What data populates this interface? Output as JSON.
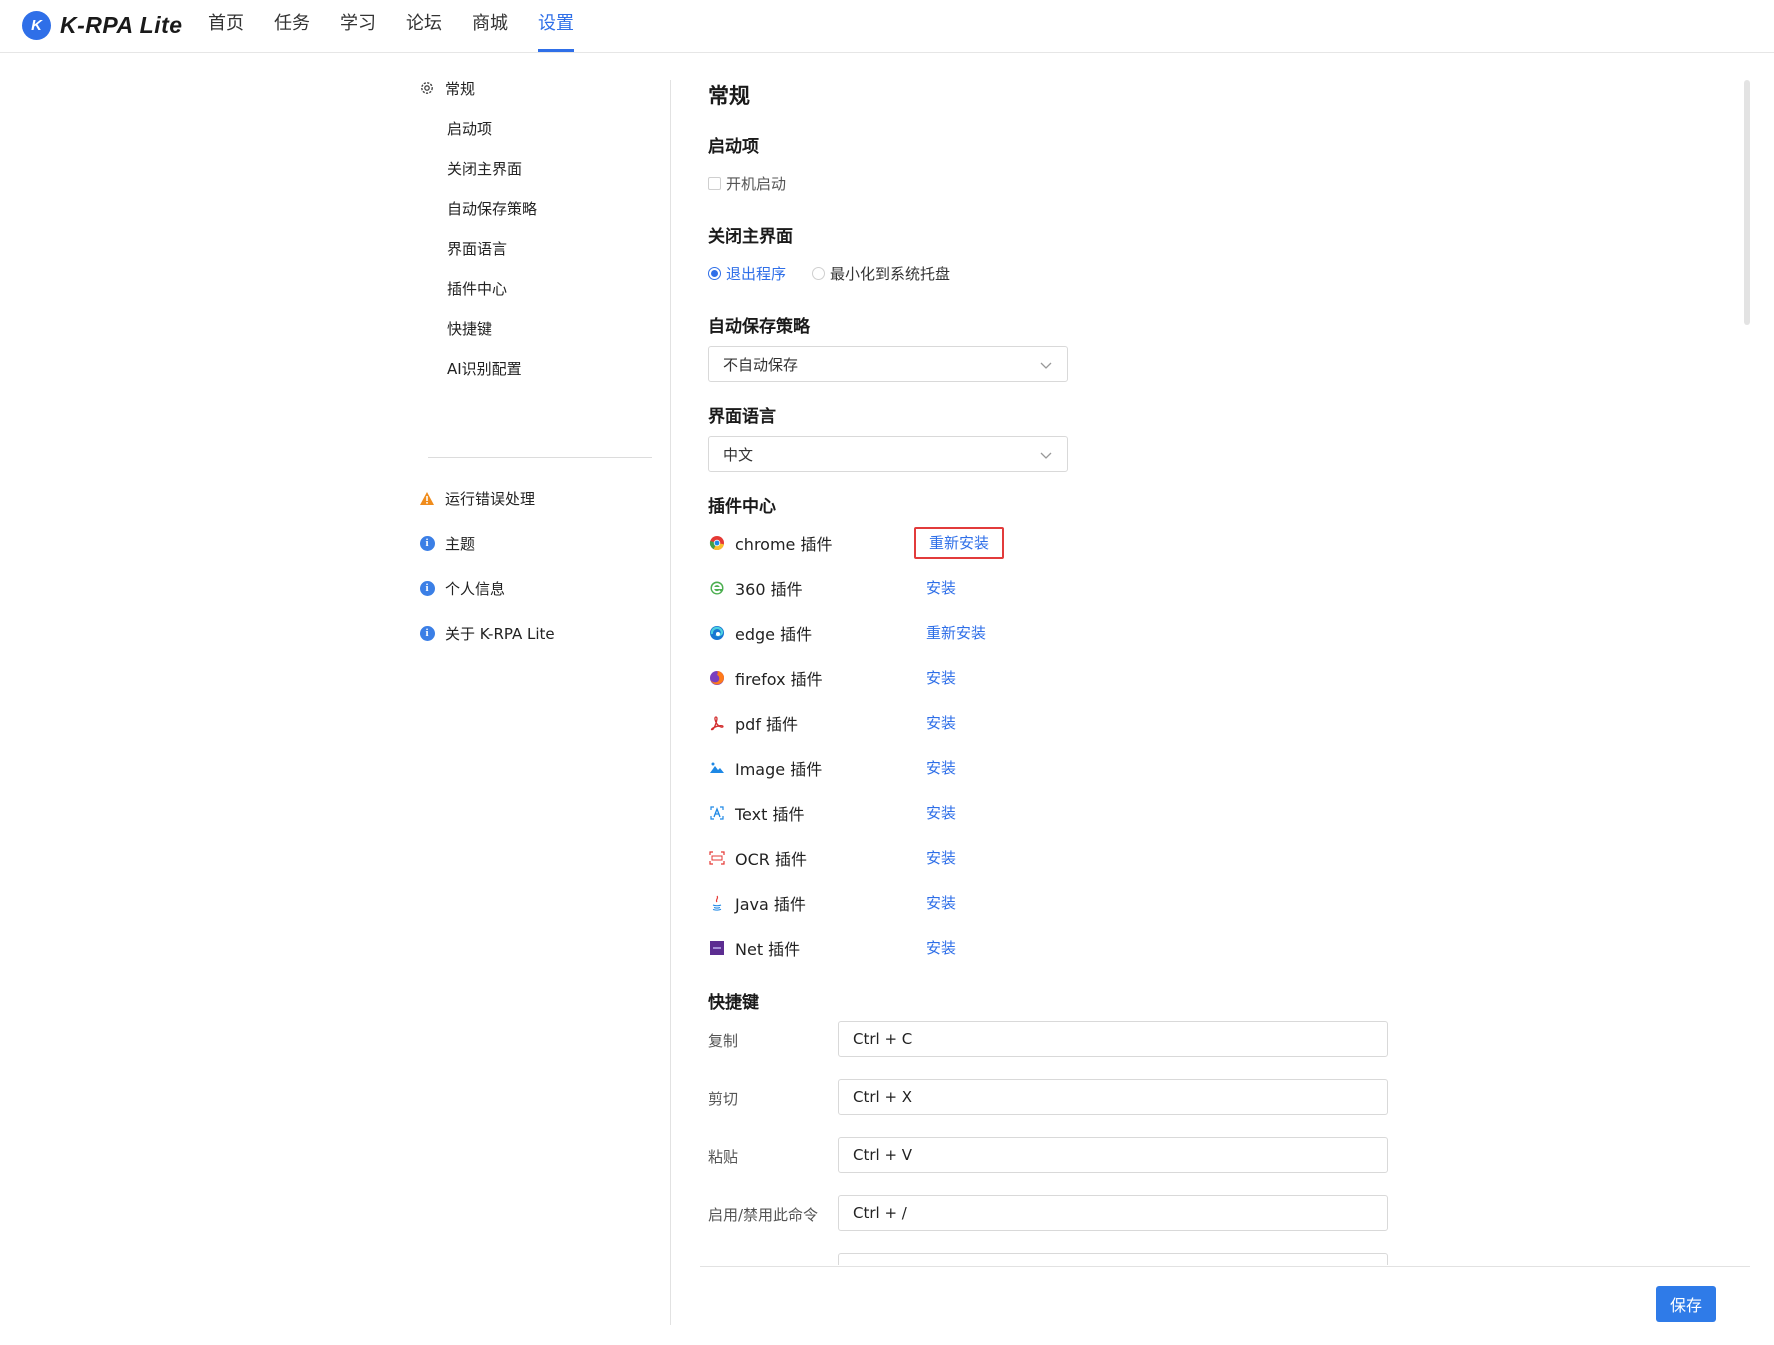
{
  "app": {
    "logo_letter": "K",
    "name": "K-RPA Lite"
  },
  "nav": [
    {
      "label": "首页",
      "active": false
    },
    {
      "label": "任务",
      "active": false
    },
    {
      "label": "学习",
      "active": false
    },
    {
      "label": "论坛",
      "active": false
    },
    {
      "label": "商城",
      "active": false
    },
    {
      "label": "设置",
      "active": true
    }
  ],
  "sidebar": {
    "general": "常规",
    "sub_items": [
      "启动项",
      "关闭主界面",
      "自动保存策略",
      "界面语言",
      "插件中心",
      "快捷键",
      "AI识别配置"
    ],
    "error_handling": "运行错误处理",
    "theme": "主题",
    "profile": "个人信息",
    "about": "关于 K-RPA Lite"
  },
  "content": {
    "title": "常规",
    "startup": {
      "heading": "启动项",
      "boot_label": "开机启动",
      "boot_checked": false
    },
    "close_main": {
      "heading": "关闭主界面",
      "exit_label": "退出程序",
      "minimize_label": "最小化到系统托盘",
      "selected": "exit"
    },
    "autosave": {
      "heading": "自动保存策略",
      "value": "不自动保存"
    },
    "language": {
      "heading": "界面语言",
      "value": "中文"
    },
    "plugins": {
      "heading": "插件中心",
      "items": [
        {
          "icon": "chrome-icon",
          "name": "chrome 插件",
          "action": "重新安装"
        },
        {
          "icon": "360-browser-icon",
          "name": "360 插件",
          "action": "安装"
        },
        {
          "icon": "edge-icon",
          "name": "edge 插件",
          "action": "重新安装"
        },
        {
          "icon": "firefox-icon",
          "name": "firefox 插件",
          "action": "安装"
        },
        {
          "icon": "pdf-icon",
          "name": "pdf 插件",
          "action": "安装"
        },
        {
          "icon": "image-icon",
          "name": "Image 插件",
          "action": "安装"
        },
        {
          "icon": "text-icon",
          "name": "Text 插件",
          "action": "安装"
        },
        {
          "icon": "ocr-icon",
          "name": "OCR 插件",
          "action": "安装"
        },
        {
          "icon": "java-icon",
          "name": "Java 插件",
          "action": "安装"
        },
        {
          "icon": "net-icon",
          "name": "Net 插件",
          "action": "安装"
        }
      ]
    },
    "shortcuts": {
      "heading": "快捷键",
      "items": [
        {
          "label": "复制",
          "value": "Ctrl + C"
        },
        {
          "label": "剪切",
          "value": "Ctrl + X"
        },
        {
          "label": "粘贴",
          "value": "Ctrl + V"
        },
        {
          "label": "启用/禁用此命令",
          "value": "Ctrl + /"
        }
      ]
    },
    "save_label": "保存"
  },
  "colors": {
    "accent": "#2f6fe8",
    "highlight_border": "#e23b3b",
    "warning": "#f08c1c"
  }
}
